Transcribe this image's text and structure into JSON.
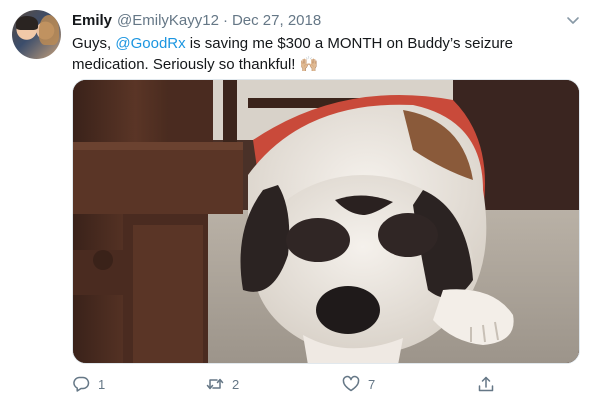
{
  "tweet": {
    "author_name": "Emily",
    "author_handle": "@EmilyKayy12",
    "separator": "·",
    "date": "Dec 27, 2018",
    "text_prefix": "Guys, ",
    "mention": "@GoodRx",
    "text_suffix": " is saving me $300 a MONTH on Buddy’s seizure medication. Seriously so thankful! ",
    "emoji": "🙌🏼"
  },
  "actions": {
    "reply_count": "1",
    "retweet_count": "2",
    "like_count": "7"
  },
  "icons": {
    "menu": "chevron-down-icon",
    "reply": "comment-icon",
    "retweet": "retweet-icon",
    "like": "heart-icon",
    "share": "share-icon"
  },
  "colors": {
    "link": "#1b95e0",
    "secondary_text": "#657786",
    "primary_text": "#14171a"
  }
}
